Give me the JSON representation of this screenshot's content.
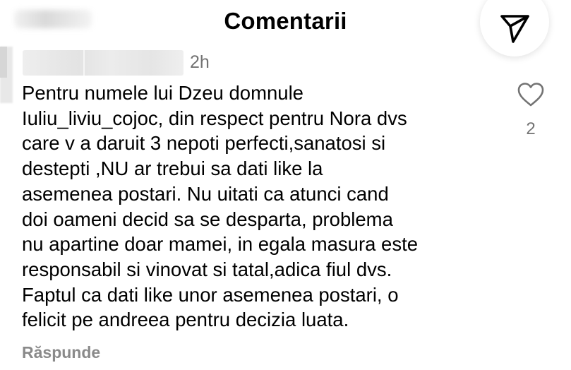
{
  "header": {
    "title": "Comentarii"
  },
  "comment": {
    "time": "2h",
    "lines": [
      "Pentru numele lui Dzeu domnule",
      "Iuliu_liviu_cojoc, din respect pentru Nora dvs",
      "care v a daruit 3 nepoti perfecti,sanatosi si",
      "destepti ,NU ar trebui sa dati like la",
      "asemenea postari. Nu uitati ca atunci cand",
      "doi oameni decid sa se desparta, problema",
      "nu apartine doar mamei, in egala masura este",
      "responsabil si vinovat si tatal,adica fiul dvs.",
      "Faptul ca dati like unor asemenea postari, o",
      "felicit pe andreea pentru decizia luata."
    ],
    "like_count": "2",
    "reply_label": "Răspunde"
  },
  "icons": {
    "share": "paper-plane-icon",
    "like": "heart-outline-icon"
  },
  "colors": {
    "text": "#000000",
    "secondary_text": "#737373",
    "reply_text": "#8a8a8a",
    "background": "#ffffff"
  }
}
